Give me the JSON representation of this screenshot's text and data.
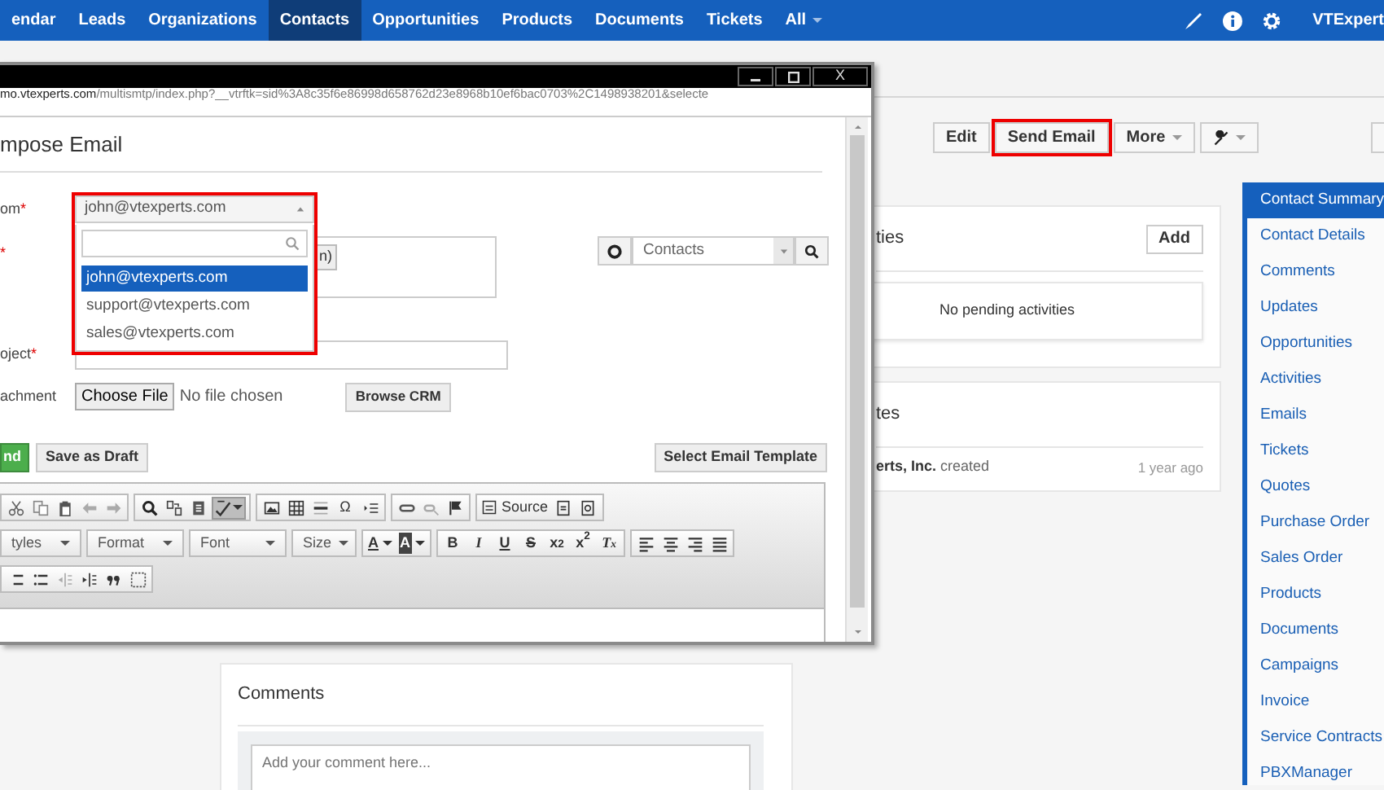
{
  "navbar": {
    "items": [
      {
        "label": "endar",
        "kind": "link",
        "selected": false
      },
      {
        "label": "Leads",
        "kind": "link",
        "selected": false
      },
      {
        "label": "Organizations",
        "kind": "link",
        "selected": false
      },
      {
        "label": "Contacts",
        "kind": "link",
        "selected": true
      },
      {
        "label": "Opportunities",
        "kind": "link",
        "selected": false
      },
      {
        "label": "Products",
        "kind": "link",
        "selected": false
      },
      {
        "label": "Documents",
        "kind": "link",
        "selected": false
      },
      {
        "label": "Tickets",
        "kind": "link",
        "selected": false
      },
      {
        "label": "All",
        "kind": "menu",
        "selected": false
      }
    ],
    "user": "VTExpert"
  },
  "actions": [
    {
      "kind": "text",
      "label": "Edit",
      "highlighted": false
    },
    {
      "kind": "text",
      "label": "Send Email",
      "highlighted": true
    },
    {
      "kind": "menu",
      "label": "More",
      "highlighted": false
    },
    {
      "kind": "tool-menu",
      "highlighted": false
    }
  ],
  "activities": {
    "title": "ties",
    "add": "Add",
    "empty": "No pending activities"
  },
  "updates": {
    "title": "tes",
    "subject": "erts, Inc.",
    "action": "created",
    "time": "1 year ago"
  },
  "comments": {
    "title": "Comments",
    "placeholder": "Add your comment here..."
  },
  "sidebar": {
    "items": [
      {
        "label": "Contact Summary",
        "selected": true
      },
      {
        "label": "Contact Details",
        "selected": false
      },
      {
        "label": "Comments",
        "selected": false
      },
      {
        "label": "Updates",
        "selected": false
      },
      {
        "label": "Opportunities",
        "selected": false
      },
      {
        "label": "Activities",
        "selected": false
      },
      {
        "label": "Emails",
        "selected": false
      },
      {
        "label": "Tickets",
        "selected": false
      },
      {
        "label": "Quotes",
        "selected": false
      },
      {
        "label": "Purchase Order",
        "selected": false
      },
      {
        "label": "Sales Order",
        "selected": false
      },
      {
        "label": "Products",
        "selected": false
      },
      {
        "label": "Documents",
        "selected": false
      },
      {
        "label": "Campaigns",
        "selected": false
      },
      {
        "label": "Invoice",
        "selected": false
      },
      {
        "label": "Service Contracts",
        "selected": false
      },
      {
        "label": "PBXManager",
        "selected": false
      }
    ]
  },
  "popup": {
    "close": "X",
    "url_host": "mo.vtexperts.com",
    "url_path": "/multismtp/index.php?__vtrftk=sid%3A8c35f6e86998d658762d23e8968b10ef6bac0703%2C1498938201&selecte",
    "title": "mpose Email",
    "from": {
      "label": "om",
      "mark": "*",
      "value": "john@vtexperts.com",
      "expanded": true,
      "highlighted": true,
      "options": [
        {
          "label": "john@vtexperts.com",
          "selected": true
        },
        {
          "label": "support@vtexperts.com",
          "selected": false
        },
        {
          "label": "sales@vtexperts.com",
          "selected": false
        }
      ]
    },
    "to": {
      "mark": "*",
      "chip": "n)"
    },
    "module_select": {
      "value": "Contacts"
    },
    "subject": {
      "label": "oject",
      "mark": "*"
    },
    "attachment": {
      "label": "achment",
      "choose": "Choose File",
      "status": "No file chosen",
      "browse": "Browse CRM"
    },
    "buttons": [
      {
        "kind": "primary",
        "label": "nd"
      },
      {
        "kind": "default",
        "label": "Save as Draft"
      },
      {
        "kind": "right",
        "label": "Select Email Template"
      }
    ],
    "toolbar": [
      [
        [
          {
            "kind": "icon",
            "active": false
          },
          {
            "kind": "icon",
            "active": false
          },
          {
            "kind": "icon",
            "active": false
          },
          {
            "kind": "icon",
            "active": false
          },
          {
            "kind": "icon",
            "active": false
          }
        ],
        [
          {
            "kind": "icon",
            "active": false
          },
          {
            "kind": "icon",
            "active": false
          },
          {
            "kind": "icon",
            "active": false
          },
          {
            "kind": "icon",
            "active": true
          }
        ],
        [
          {
            "kind": "icon",
            "active": false
          },
          {
            "kind": "icon",
            "active": false
          },
          {
            "kind": "icon",
            "active": false
          },
          {
            "kind": "glyph",
            "text": "Ω"
          },
          {
            "kind": "icon",
            "active": false
          }
        ],
        [
          {
            "kind": "icon",
            "active": false
          },
          {
            "kind": "icon",
            "active": false
          },
          {
            "kind": "icon",
            "active": false
          }
        ],
        [
          {
            "kind": "source",
            "label": "Source"
          },
          {
            "kind": "icon",
            "active": false
          },
          {
            "kind": "icon",
            "active": false
          }
        ]
      ],
      [
        [
          {
            "kind": "combo",
            "label": "tyles"
          }
        ],
        [
          {
            "kind": "combo",
            "label": "Format"
          }
        ],
        [
          {
            "kind": "combo",
            "label": "Font"
          }
        ],
        [
          {
            "kind": "combo",
            "label": "Size"
          }
        ],
        [
          {
            "kind": "color",
            "text": "A",
            "filled": false
          },
          {
            "kind": "color",
            "text": "A",
            "filled": true
          }
        ],
        [
          {
            "kind": "glyph",
            "text": "B"
          },
          {
            "kind": "glyph",
            "text": "I"
          },
          {
            "kind": "glyph",
            "text": "U"
          },
          {
            "kind": "glyph",
            "text": "S"
          },
          {
            "kind": "glyph",
            "text": "x$_{2}$"
          },
          {
            "kind": "glyph",
            "text": "x$^{2}$"
          },
          {
            "kind": "glyph",
            "text": "T$_{x}$"
          }
        ],
        [
          {
            "kind": "icon",
            "active": false
          },
          {
            "kind": "icon",
            "active": false
          },
          {
            "kind": "icon",
            "active": false
          },
          {
            "kind": "icon",
            "active": false
          }
        ]
      ],
      [
        [
          {
            "kind": "icon",
            "active": false
          },
          {
            "kind": "icon",
            "active": false
          },
          {
            "kind": "icon",
            "active": false
          },
          {
            "kind": "icon",
            "active": false
          },
          {
            "kind": "icon",
            "active": false
          },
          {
            "kind": "icon",
            "active": false
          }
        ]
      ]
    ]
  }
}
